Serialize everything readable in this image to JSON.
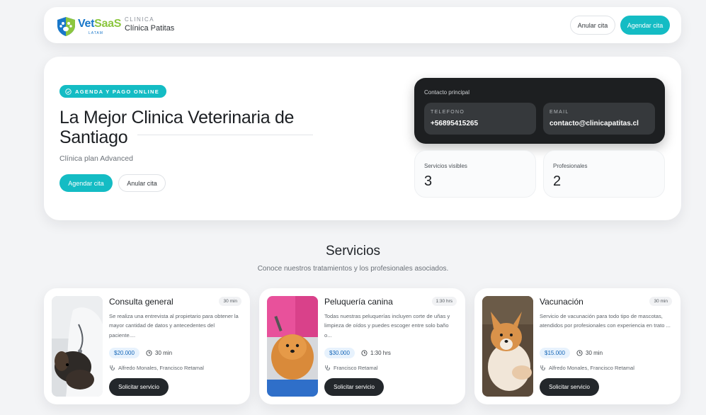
{
  "header": {
    "logo_text_a": "Vet",
    "logo_text_b": "SaaS",
    "logo_sub": "LATAM",
    "clinic_label": "CLINICA",
    "clinic_name": "Clínica Patitas",
    "cancel_label": "Anular cita",
    "book_label": "Agendar cita"
  },
  "hero": {
    "badge": "AGENDA Y PAGO ONLINE",
    "title": "La Mejor Clinica Veterinaria de Santiago",
    "subtitle": "Clínica plan Advanced",
    "book_label": "Agendar cita",
    "cancel_label": "Anular cita",
    "contact": {
      "title": "Contacto principal",
      "phone_key": "TELEFONO",
      "phone": "+56895415265",
      "email_key": "EMAIL",
      "email": "contacto@clinicapatitas.cl"
    },
    "stats": [
      {
        "label": "Servicios visibles",
        "value": "3"
      },
      {
        "label": "Profesionales",
        "value": "2"
      }
    ]
  },
  "services_section": {
    "title": "Servicios",
    "subtitle": "Conoce nuestros tratamientos y los profesionales asociados."
  },
  "services": [
    {
      "name": "Consulta general",
      "duration_pill": "30 min",
      "description": "Se realiza una entrevista al propietario para obtener la mayor cantidad de datos y antecedentes del paciente....",
      "price": "$20.000",
      "duration": "30 min",
      "professionals": "Alfredo Monales, Francisco Retamal",
      "button": "Solicitar servicio"
    },
    {
      "name": "Peluquería canina",
      "duration_pill": "1:30 hrs",
      "description": "Todas nuestras peluquerías incluyen corte de uñas y limpieza de oídos y puedes escoger entre solo baño o...",
      "price": "$30.000",
      "duration": "1:30 hrs",
      "professionals": "Francisco Retamal",
      "button": "Solicitar servicio"
    },
    {
      "name": "Vacunación",
      "duration_pill": "30 min",
      "description": "Servicio de vacunación para todo tipo de mascotas, atendidos por profesionales con experiencia en trato ...",
      "price": "$15.000",
      "duration": "30 min",
      "professionals": "Alfredo Monales, Francisco Retamal",
      "button": "Solicitar servicio"
    }
  ],
  "colors": {
    "accent": "#14bcc4",
    "dark": "#1d1f21",
    "price_bg": "#e7f2fd"
  }
}
